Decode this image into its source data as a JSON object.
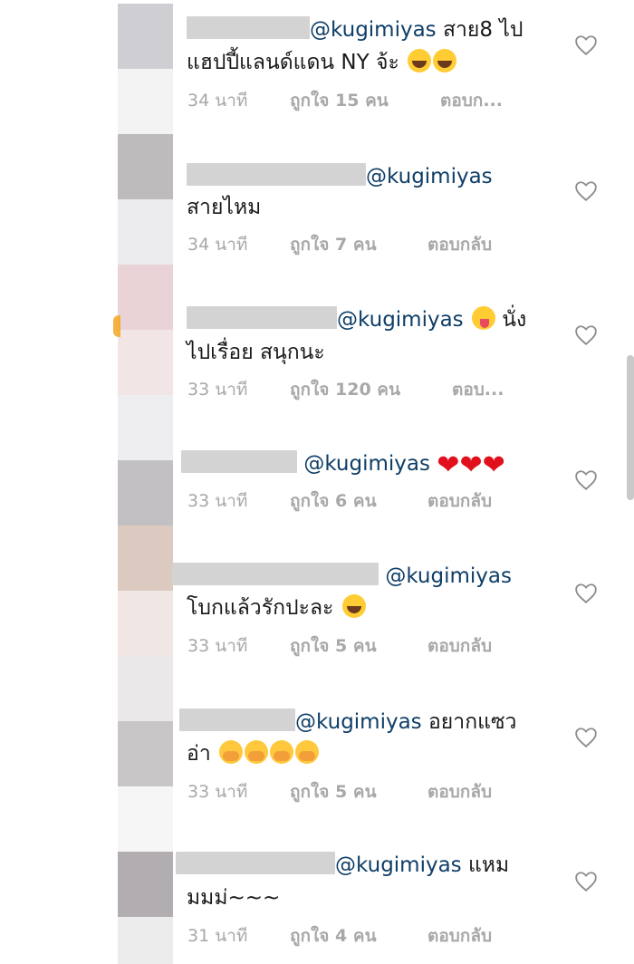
{
  "comments": [
    {
      "id": "c1",
      "mention": "@kugimiyas",
      "line1_text": " สาย8 ไป",
      "line2_text": "แฮปปี้แลนด์แดน NY จ้ะ",
      "time": "34 นาที",
      "likes": "ถูกใจ 15 คน",
      "reply": "ตอบก..."
    },
    {
      "id": "c2",
      "mention": "@kugimiyas",
      "line2_text": "สายไหม",
      "time": "34 นาที",
      "likes": "ถูกใจ 7 คน",
      "reply": "ตอบกลับ"
    },
    {
      "id": "c3",
      "mention": "@kugimiyas",
      "line1_text": " นั่ง",
      "line2_text": "ไปเรื่อย สนุกนะ",
      "time": "33 นาที",
      "likes": "ถูกใจ 120 คน",
      "reply": "ตอบ..."
    },
    {
      "id": "c4",
      "mention": "@kugimiyas",
      "time": "33 นาที",
      "likes": "ถูกใจ 6 คน",
      "reply": "ตอบกลับ"
    },
    {
      "id": "c5",
      "mention": "@kugimiyas",
      "line2_text": "โบกแล้วรักปะละ",
      "time": "33 นาที",
      "likes": "ถูกใจ 5 คน",
      "reply": "ตอบกลับ"
    },
    {
      "id": "c6",
      "mention": "@kugimiyas",
      "line1_text": "  อยากแซว",
      "line2_text": "อ่า",
      "time": "33 นาที",
      "likes": "ถูกใจ 5 คน",
      "reply": "ตอบกลับ"
    },
    {
      "id": "c7",
      "mention": "@kugimiyas",
      "line1_text": " แหม",
      "line2_text": "มมม่~~~",
      "time": "31 นาที",
      "likes": "ถูกใจ 4 คน",
      "reply": "ตอบกลับ"
    }
  ],
  "icons": {
    "like": "heart-outline-icon"
  },
  "colors": {
    "mention": "#0f3e68",
    "meta": "#a8a8a8",
    "heart_emoji": "#e0101d"
  }
}
